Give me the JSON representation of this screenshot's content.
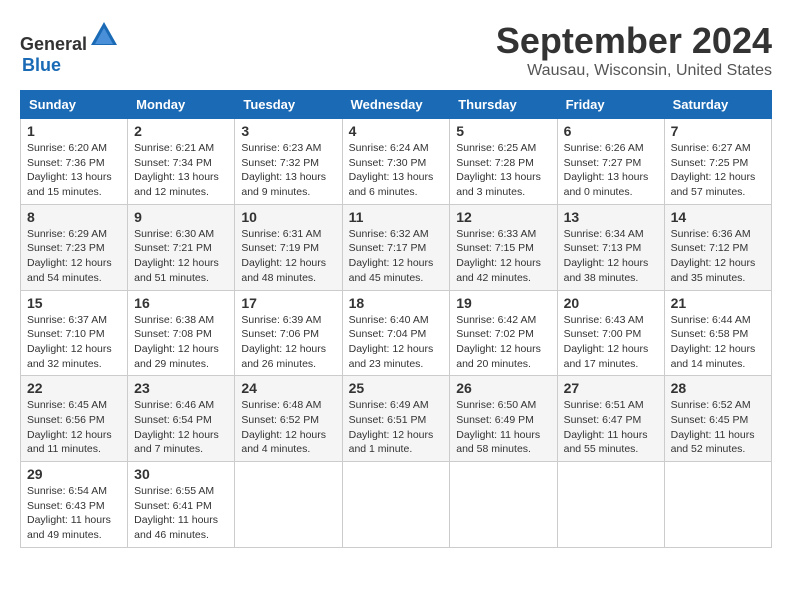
{
  "header": {
    "logo_general": "General",
    "logo_blue": "Blue",
    "month_title": "September 2024",
    "location": "Wausau, Wisconsin, United States"
  },
  "weekdays": [
    "Sunday",
    "Monday",
    "Tuesday",
    "Wednesday",
    "Thursday",
    "Friday",
    "Saturday"
  ],
  "weeks": [
    [
      {
        "day": "1",
        "info": "Sunrise: 6:20 AM\nSunset: 7:36 PM\nDaylight: 13 hours\nand 15 minutes."
      },
      {
        "day": "2",
        "info": "Sunrise: 6:21 AM\nSunset: 7:34 PM\nDaylight: 13 hours\nand 12 minutes."
      },
      {
        "day": "3",
        "info": "Sunrise: 6:23 AM\nSunset: 7:32 PM\nDaylight: 13 hours\nand 9 minutes."
      },
      {
        "day": "4",
        "info": "Sunrise: 6:24 AM\nSunset: 7:30 PM\nDaylight: 13 hours\nand 6 minutes."
      },
      {
        "day": "5",
        "info": "Sunrise: 6:25 AM\nSunset: 7:28 PM\nDaylight: 13 hours\nand 3 minutes."
      },
      {
        "day": "6",
        "info": "Sunrise: 6:26 AM\nSunset: 7:27 PM\nDaylight: 13 hours\nand 0 minutes."
      },
      {
        "day": "7",
        "info": "Sunrise: 6:27 AM\nSunset: 7:25 PM\nDaylight: 12 hours\nand 57 minutes."
      }
    ],
    [
      {
        "day": "8",
        "info": "Sunrise: 6:29 AM\nSunset: 7:23 PM\nDaylight: 12 hours\nand 54 minutes."
      },
      {
        "day": "9",
        "info": "Sunrise: 6:30 AM\nSunset: 7:21 PM\nDaylight: 12 hours\nand 51 minutes."
      },
      {
        "day": "10",
        "info": "Sunrise: 6:31 AM\nSunset: 7:19 PM\nDaylight: 12 hours\nand 48 minutes."
      },
      {
        "day": "11",
        "info": "Sunrise: 6:32 AM\nSunset: 7:17 PM\nDaylight: 12 hours\nand 45 minutes."
      },
      {
        "day": "12",
        "info": "Sunrise: 6:33 AM\nSunset: 7:15 PM\nDaylight: 12 hours\nand 42 minutes."
      },
      {
        "day": "13",
        "info": "Sunrise: 6:34 AM\nSunset: 7:13 PM\nDaylight: 12 hours\nand 38 minutes."
      },
      {
        "day": "14",
        "info": "Sunrise: 6:36 AM\nSunset: 7:12 PM\nDaylight: 12 hours\nand 35 minutes."
      }
    ],
    [
      {
        "day": "15",
        "info": "Sunrise: 6:37 AM\nSunset: 7:10 PM\nDaylight: 12 hours\nand 32 minutes."
      },
      {
        "day": "16",
        "info": "Sunrise: 6:38 AM\nSunset: 7:08 PM\nDaylight: 12 hours\nand 29 minutes."
      },
      {
        "day": "17",
        "info": "Sunrise: 6:39 AM\nSunset: 7:06 PM\nDaylight: 12 hours\nand 26 minutes."
      },
      {
        "day": "18",
        "info": "Sunrise: 6:40 AM\nSunset: 7:04 PM\nDaylight: 12 hours\nand 23 minutes."
      },
      {
        "day": "19",
        "info": "Sunrise: 6:42 AM\nSunset: 7:02 PM\nDaylight: 12 hours\nand 20 minutes."
      },
      {
        "day": "20",
        "info": "Sunrise: 6:43 AM\nSunset: 7:00 PM\nDaylight: 12 hours\nand 17 minutes."
      },
      {
        "day": "21",
        "info": "Sunrise: 6:44 AM\nSunset: 6:58 PM\nDaylight: 12 hours\nand 14 minutes."
      }
    ],
    [
      {
        "day": "22",
        "info": "Sunrise: 6:45 AM\nSunset: 6:56 PM\nDaylight: 12 hours\nand 11 minutes."
      },
      {
        "day": "23",
        "info": "Sunrise: 6:46 AM\nSunset: 6:54 PM\nDaylight: 12 hours\nand 7 minutes."
      },
      {
        "day": "24",
        "info": "Sunrise: 6:48 AM\nSunset: 6:52 PM\nDaylight: 12 hours\nand 4 minutes."
      },
      {
        "day": "25",
        "info": "Sunrise: 6:49 AM\nSunset: 6:51 PM\nDaylight: 12 hours\nand 1 minute."
      },
      {
        "day": "26",
        "info": "Sunrise: 6:50 AM\nSunset: 6:49 PM\nDaylight: 11 hours\nand 58 minutes."
      },
      {
        "day": "27",
        "info": "Sunrise: 6:51 AM\nSunset: 6:47 PM\nDaylight: 11 hours\nand 55 minutes."
      },
      {
        "day": "28",
        "info": "Sunrise: 6:52 AM\nSunset: 6:45 PM\nDaylight: 11 hours\nand 52 minutes."
      }
    ],
    [
      {
        "day": "29",
        "info": "Sunrise: 6:54 AM\nSunset: 6:43 PM\nDaylight: 11 hours\nand 49 minutes."
      },
      {
        "day": "30",
        "info": "Sunrise: 6:55 AM\nSunset: 6:41 PM\nDaylight: 11 hours\nand 46 minutes."
      },
      {
        "day": "",
        "info": ""
      },
      {
        "day": "",
        "info": ""
      },
      {
        "day": "",
        "info": ""
      },
      {
        "day": "",
        "info": ""
      },
      {
        "day": "",
        "info": ""
      }
    ]
  ]
}
